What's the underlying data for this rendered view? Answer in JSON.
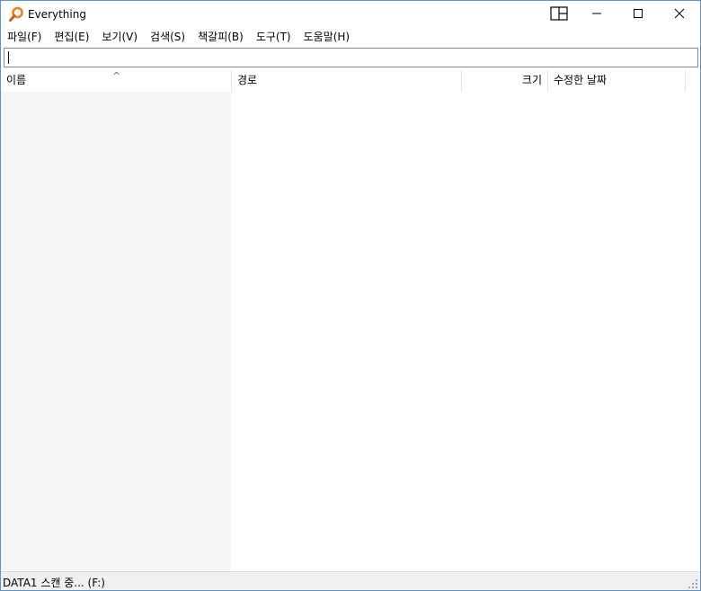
{
  "window": {
    "title": "Everything",
    "accent_color": "#e8821e",
    "border_color": "#5a93c8"
  },
  "icons": {
    "app": "magnifier-icon",
    "layout": "layout-panes-icon",
    "minimize": "minimize-icon",
    "maximize": "maximize-icon",
    "close": "close-icon",
    "sort": "sort-ascending-icon",
    "grip": "resize-grip-icon"
  },
  "menu": {
    "items": [
      {
        "label": "파일(F)"
      },
      {
        "label": "편집(E)"
      },
      {
        "label": "보기(V)"
      },
      {
        "label": "검색(S)"
      },
      {
        "label": "책갈피(B)"
      },
      {
        "label": "도구(T)"
      },
      {
        "label": "도움말(H)"
      }
    ]
  },
  "search": {
    "value": "",
    "placeholder": ""
  },
  "columns": {
    "name": "이름",
    "path": "경로",
    "size": "크기",
    "modified": "수정한 날짜",
    "sort_indicator": "^"
  },
  "status": {
    "text": "DATA1 스캔 중... (F:)"
  }
}
